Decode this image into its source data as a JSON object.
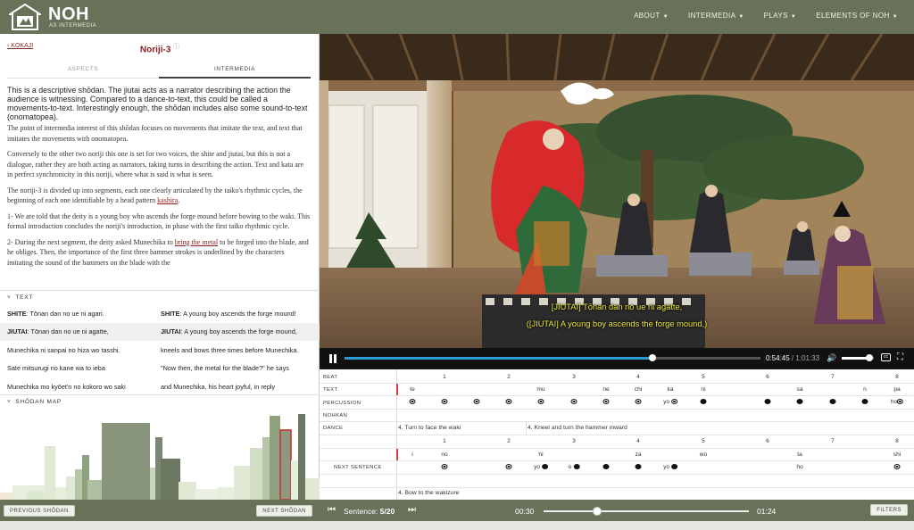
{
  "brand": {
    "name": "NOH",
    "subtitle": "AS INTERMEDIA"
  },
  "nav": [
    {
      "label": "ABOUT"
    },
    {
      "label": "INTERMEDIA"
    },
    {
      "label": "PLAYS"
    },
    {
      "label": "ELEMENTS OF NOH"
    }
  ],
  "left": {
    "back_label": "KOKAJI",
    "title": "Noriji-3",
    "tabs": [
      "ASPECTS",
      "INTERMEDIA"
    ],
    "active_tab": "INTERMEDIA",
    "lead": "This is a descriptive shōdan. The jiutai acts as a narrator describing the action the audience is witnessing. Compared to a dance-to-text, this could be called a movements-to-text. Interestingly enough, the shōdan includes also some sound-to-text (onomatopea).",
    "p1": "The point of intermedia interest of this shōdan focuses on movements that imitate the text, and text that imitates the movements with onomatopea.",
    "p2": "Conversely to the other two noriji this one is set for two voices, the shite and jiutai, but this is not a dialogue, rather they are both acting as narrators, taking turns in describing the action. Text and kata are in perfect synchronicity in this noriji, where what is said is what is seen.",
    "p3a": "The noriji-3 is divided up into segments, each one clearly articulated by the taiko's rhythmic cycles, the beginning of each one identifiable by a head pattern ",
    "p3_link": "kashira",
    "p3b": ".",
    "p4": "1- We are told that the deity is a young boy who ascends the forge mound before bowing to the waki. This formal introduction concludes the noriji's introduction, in phase with the first taiko rhythmic cycle.",
    "p5a": "2- During the next segment, the deity asked Munechika to ",
    "p5_link": "bring the metal",
    "p5b": " to be forged into the blade, and he obliges. Then, the importance of the first three hammer strokes is underlined by the characters imitating the sound of the hammers on the blade with the",
    "text_section": "TEXT",
    "text_rows": [
      {
        "jp_speaker": "SHITE",
        "jp": ": Tōnan dan no ue ni agari.",
        "en_speaker": "SHITE",
        "en": ": A young boy ascends the forge mound!"
      },
      {
        "jp_speaker": "JIUTAI",
        "jp": ": Tōnan dan no ue ni agatte,",
        "en_speaker": "JIUTAI",
        "en": ": A young boy ascends the forge mound,"
      },
      {
        "jp_speaker": "",
        "jp": "Munechika ni sanpai no hiza wo tasshi.",
        "en_speaker": "",
        "en": "kneels and bows three times before Munechika."
      },
      {
        "jp_speaker": "",
        "jp": "Sate mitsurugi no kane wa to ieba",
        "en_speaker": "",
        "en": "\"Now then, the metal for the blade?\" he says"
      },
      {
        "jp_speaker": "",
        "jp": "Munechika mo kyōet'n no kokoro wo saki",
        "en_speaker": "",
        "en": "and Munechika, his heart joyful, in reply"
      }
    ],
    "map_section": "SHŌDAN MAP",
    "prev_button": "PREVIOUS SHŌDAN",
    "next_button": "NEXT SHŌDAN"
  },
  "video": {
    "subtitle_jp": "[JIUTAI] Tōnan dan no ue ni agatte,",
    "subtitle_en": "([JIUTAI] A young boy ascends the forge mound,)",
    "current_time": "0:54:45",
    "duration": "1:01:33",
    "progress": 0.74,
    "volume": 0.85
  },
  "score": {
    "labels": {
      "beat": "BEAT",
      "text": "TEXT",
      "percussion": "PERCUSSION",
      "nohkan": "NOHKAN",
      "dance": "DANCE",
      "next": "NEXT SENTENCE"
    },
    "beats": [
      "1",
      "2",
      "3",
      "4",
      "5",
      "6",
      "7",
      "8"
    ],
    "text_syllables": [
      "te",
      "mu",
      "ne",
      "chi",
      "ka",
      "ni",
      "sa",
      "n",
      "pa"
    ],
    "perc_yo1": "yo",
    "perc_ho1": "ho",
    "dance1": "4. Turn to face the waki",
    "dance2": "4. Kneel and turn the hammer inward",
    "next_syllables": [
      "i",
      "no",
      "hi",
      "za",
      "wo",
      "ta",
      "shi"
    ],
    "next_perc_yo": "yo",
    "next_perc_o": "o",
    "next_perc_yo2": "yo",
    "next_perc_ho": "ho",
    "next_dance": "4. Bow to the wakizure"
  },
  "bottom": {
    "sentence_label": "Sentence:",
    "sentence_value": "5/20",
    "time_start": "00:30",
    "time_end": "01:24",
    "slider_position": 0.26,
    "filters_button": "FILTERS"
  }
}
